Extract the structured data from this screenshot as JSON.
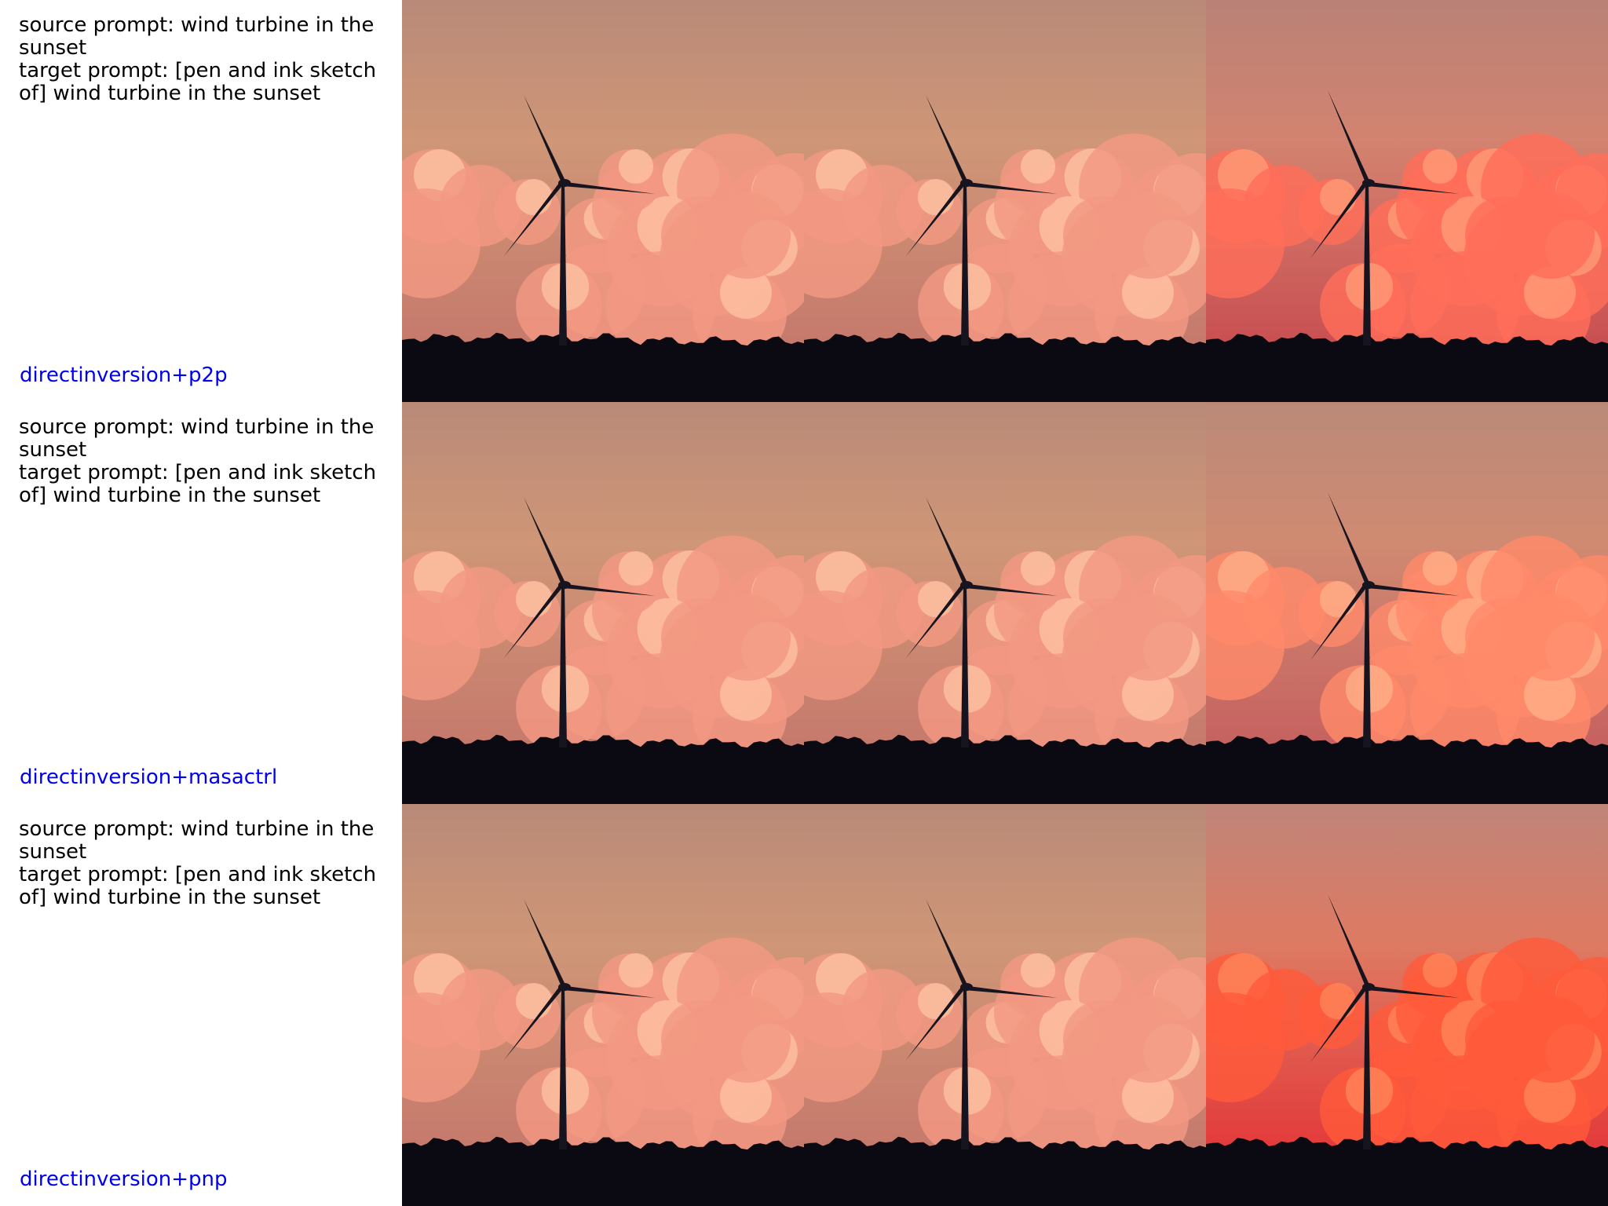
{
  "rows": [
    {
      "source_prompt": "source prompt: wind turbine in the sunset",
      "target_prompt": "target prompt: [pen and ink sketch of] wind turbine in the sunset",
      "method": "directinversion+p2p",
      "tiles": [
        {
          "variant": "source",
          "sky_top": "#b98a78",
          "sky_mid": "#cf9677",
          "sky_low": "#c67a6c",
          "cloud": "#f39882",
          "cloud_hi": "#ffc7a6"
        },
        {
          "variant": "reconstruction",
          "sky_top": "#b98a78",
          "sky_mid": "#cf9677",
          "sky_low": "#c67a6c",
          "cloud": "#f39882",
          "cloud_hi": "#ffc7a6"
        },
        {
          "variant": "edited",
          "sky_top": "#b98276",
          "sky_mid": "#d38370",
          "sky_low": "#c95052",
          "cloud": "#ff6e59",
          "cloud_hi": "#ffa17b"
        }
      ]
    },
    {
      "source_prompt": "source prompt: wind turbine in the sunset",
      "target_prompt": "target prompt: [pen and ink sketch of] wind turbine in the sunset",
      "method": "directinversion+masactrl",
      "tiles": [
        {
          "variant": "source",
          "sky_top": "#b98a78",
          "sky_mid": "#cf9677",
          "sky_low": "#c67a6c",
          "cloud": "#f39882",
          "cloud_hi": "#ffc7a6"
        },
        {
          "variant": "reconstruction",
          "sky_top": "#b98a78",
          "sky_mid": "#cf9677",
          "sky_low": "#c67a6c",
          "cloud": "#f39882",
          "cloud_hi": "#ffc7a6"
        },
        {
          "variant": "edited",
          "sky_top": "#ba8a79",
          "sky_mid": "#d08a72",
          "sky_low": "#c66260",
          "cloud": "#ff8a6a",
          "cloud_hi": "#ffb38c"
        }
      ]
    },
    {
      "source_prompt": "source prompt: wind turbine in the sunset",
      "target_prompt": "target prompt: [pen and ink sketch of] wind turbine in the sunset",
      "method": "directinversion+pnp",
      "tiles": [
        {
          "variant": "source",
          "sky_top": "#b98a78",
          "sky_mid": "#cf9677",
          "sky_low": "#c67a6c",
          "cloud": "#f39882",
          "cloud_hi": "#ffc7a6"
        },
        {
          "variant": "reconstruction",
          "sky_top": "#b98a78",
          "sky_mid": "#cf9677",
          "sky_low": "#c67a6c",
          "cloud": "#f39882",
          "cloud_hi": "#ffc7a6"
        },
        {
          "variant": "edited",
          "sky_top": "#c0857a",
          "sky_mid": "#de7a62",
          "sky_low": "#e33b3b",
          "cloud": "#ff5a3a",
          "cloud_hi": "#ff8a5c"
        }
      ]
    }
  ]
}
